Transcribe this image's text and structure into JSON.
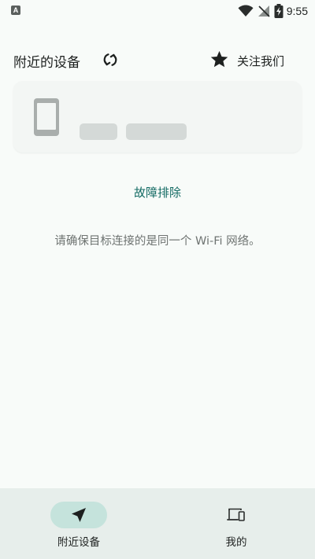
{
  "status_bar": {
    "left_icon": "notification-a-icon",
    "left_icon_glyph": "A",
    "icons": [
      "wifi-icon",
      "signal-off-icon",
      "battery-charging-icon"
    ],
    "time": "9:55"
  },
  "header": {
    "title": "附近的设备",
    "refresh_icon": "refresh-icon",
    "follow_icon": "star-icon",
    "follow_label": "关注我们"
  },
  "device_card": {
    "device_icon": "smartphone-icon",
    "loading": true
  },
  "troubleshoot": {
    "label": "故障排除"
  },
  "hint": {
    "text": "请确保目标连接的是同一个 Wi-Fi 网络。"
  },
  "bottom_nav": {
    "items": [
      {
        "label": "附近设备",
        "icon": "navigation-arrow-icon",
        "selected": true
      },
      {
        "label": "我的",
        "icon": "devices-icon",
        "selected": false
      }
    ]
  },
  "colors": {
    "background": "#f8fbf9",
    "accent": "#126a63",
    "nav_background": "#e7eeeb",
    "nav_pill": "#c5e3dc",
    "placeholder": "#d4d9d7"
  }
}
